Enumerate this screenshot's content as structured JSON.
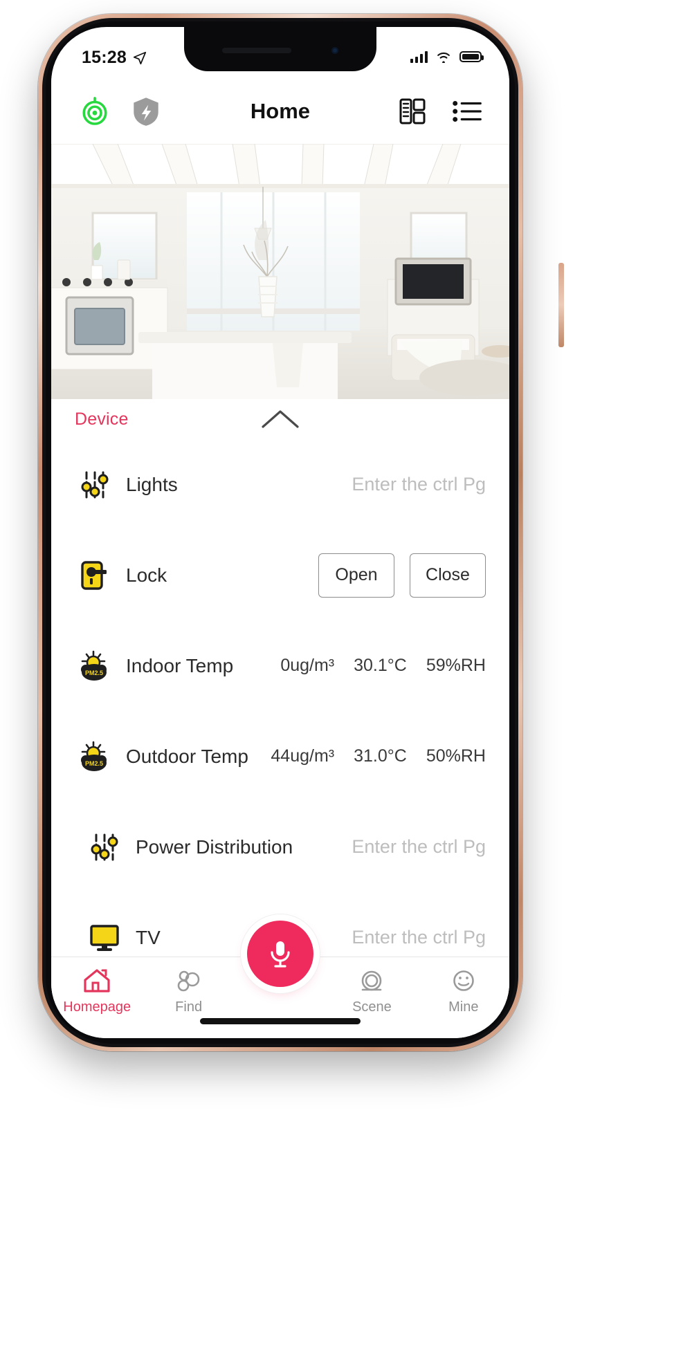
{
  "status_bar": {
    "time": "15:28",
    "location_icon": "location-arrow-icon",
    "signal_icon": "cellular-signal-icon",
    "wifi_icon": "wifi-icon",
    "battery_icon": "battery-full-icon"
  },
  "navbar": {
    "title": "Home",
    "camera_icon": "camera-monitor-icon",
    "shield_icon": "security-shield-icon",
    "rooms_icon": "rooms-grid-icon",
    "menu_icon": "list-menu-icon"
  },
  "hero": {
    "alt": "modern-white-kitchen-living-room-photo"
  },
  "panel": {
    "section_title": "Device",
    "collapse_icon": "chevron-up-icon",
    "devices": [
      {
        "name": "Lights",
        "icon": "sliders-control-icon",
        "action_type": "hint",
        "hint": "Enter the ctrl Pg"
      },
      {
        "name": "Lock",
        "icon": "door-lock-icon",
        "action_type": "buttons",
        "buttons": [
          "Open",
          "Close"
        ]
      },
      {
        "name": "Indoor Temp",
        "icon": "pm25-sun-cloud-icon",
        "action_type": "metrics",
        "metrics": [
          "0ug/m³",
          "30.1°C",
          "59%RH"
        ]
      },
      {
        "name": "Outdoor Temp",
        "icon": "pm25-sun-cloud-icon",
        "action_type": "metrics",
        "metrics": [
          "44ug/m³",
          "31.0°C",
          "50%RH"
        ]
      },
      {
        "name": "Power Distribution",
        "icon": "sliders-control-icon",
        "action_type": "hint",
        "hint": "Enter the ctrl Pg"
      },
      {
        "name": "TV",
        "icon": "tv-monitor-icon",
        "action_type": "hint",
        "hint": "Enter the ctrl Pg"
      }
    ]
  },
  "tabbar": {
    "items": [
      {
        "label": "Homepage",
        "icon": "home-icon",
        "active": true
      },
      {
        "label": "Find",
        "icon": "discover-bubbles-icon",
        "active": false
      },
      {
        "label": "Scene",
        "icon": "scene-rings-icon",
        "active": false
      },
      {
        "label": "Mine",
        "icon": "profile-smiley-icon",
        "active": false
      }
    ],
    "mic_button": {
      "icon": "microphone-icon"
    }
  },
  "colors": {
    "accent": "#e4365c",
    "mic": "#ef2b5e",
    "device_icon_yellow": "#f5d518",
    "camera_green": "#27d83f",
    "shield_gray": "#9b9b9b",
    "hint_gray": "#bdbdbd"
  }
}
